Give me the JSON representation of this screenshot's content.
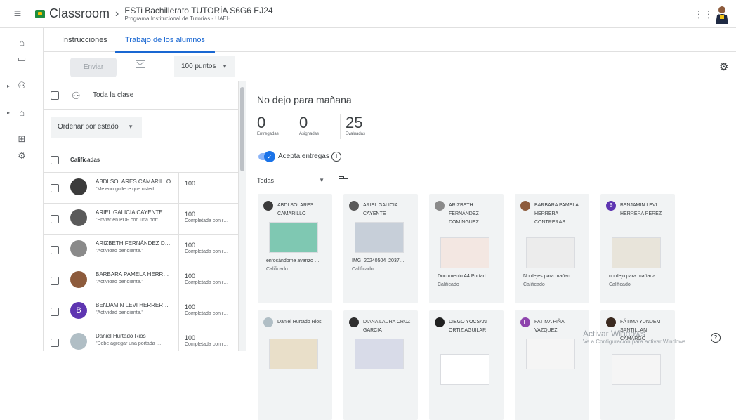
{
  "header": {
    "app_name": "Classroom",
    "course_title": "ESTi Bachillerato TUTORÍA S6G6 EJ24",
    "course_subtitle": "Programa Institucional de Tutorías - UAEH"
  },
  "tabs": [
    {
      "label": "Instrucciones",
      "active": false
    },
    {
      "label": "Trabajo de los alumnos",
      "active": true
    }
  ],
  "toolbar": {
    "send_label": "Enviar",
    "points_value": "100 puntos"
  },
  "left_panel": {
    "whole_class_label": "Toda la clase",
    "sort_label": "Ordenar por estado",
    "graded_header": "Calificadas",
    "students": [
      {
        "name": "ABDI SOLARES CAMARILLO",
        "comment": "\"Me enorgullece que usted …",
        "grade": "100",
        "status": "",
        "avatar_color": "#3b3b3b"
      },
      {
        "name": "ARIEL GALICIA CAYENTE",
        "comment": "\"Enviar en PDF con una port…",
        "grade": "100",
        "status": "Completada con r…",
        "avatar_color": "#5a5a5a"
      },
      {
        "name": "ARIZBETH FERNÁNDEZ D…",
        "comment": "\"Actividad pendiente.\"",
        "grade": "100",
        "status": "Completada con r…",
        "avatar_color": "#8a8a8a"
      },
      {
        "name": "BARBARA PAMELA HERR…",
        "comment": "\"Actividad pendiente.\"",
        "grade": "100",
        "status": "Completada con r…",
        "avatar_color": "#8d5b3c"
      },
      {
        "name": "BENJAMIN LEVI HERRER…",
        "comment": "\"Actividad pendiente.\"",
        "grade": "100",
        "status": "Completada con r…",
        "avatar_color": "#5e35b1",
        "initial": "B"
      },
      {
        "name": "Daniel Hurtado Rios",
        "comment": "\"Debe agregar una portada …",
        "grade": "100",
        "status": "Completada con r…",
        "avatar_color": "#b0bec5"
      }
    ]
  },
  "assignment": {
    "title": "No dejo para mañana",
    "stats": [
      {
        "value": "0",
        "label": "Entregadas"
      },
      {
        "value": "0",
        "label": "Asignadas"
      },
      {
        "value": "25",
        "label": "Evaluadas"
      }
    ],
    "accepting_label": "Acepta entregas",
    "filter_label": "Todas",
    "cards": [
      {
        "name": "ABDI SOLARES CAMARILLO",
        "file": "enfocándome avanzo …",
        "status": "Calificado",
        "avatar_color": "#3b3b3b",
        "thumb_color": "#7fc8b2"
      },
      {
        "name": "ARIEL GALICIA CAYENTE",
        "file": "IMG_20240504_2037…",
        "status": "Calificado",
        "avatar_color": "#5a5a5a",
        "thumb_color": "#c7cfd9"
      },
      {
        "name": "ARIZBETH FERNÁNDEZ DOMÍNGUEZ",
        "file": "Documento A4 Portad…",
        "status": "Calificado",
        "avatar_color": "#8a8a8a",
        "thumb_color": "#f3e7e2"
      },
      {
        "name": "BARBARA PAMELA HERRERA CONTRERAS",
        "file": "No dejes para mañan…",
        "status": "Calificado",
        "avatar_color": "#8d5b3c",
        "thumb_color": "#ececec"
      },
      {
        "name": "BENJAMIN LEVI HERRERA PEREZ",
        "file": "no dejo para mañana.…",
        "status": "Calificado",
        "avatar_color": "#5e35b1",
        "initial": "B",
        "thumb_color": "#e8e4da"
      },
      {
        "name": "Daniel Hurtado Rios",
        "file": "",
        "status": "",
        "avatar_color": "#b0bec5",
        "thumb_color": "#e9dfc9"
      },
      {
        "name": "DIANA LAURA CRUZ GARCIA",
        "file": "",
        "status": "",
        "avatar_color": "#2f2f2f",
        "thumb_color": "#d8dbe8"
      },
      {
        "name": "DIEGO YOCSAN ORTIZ AGUILAR",
        "file": "",
        "status": "",
        "avatar_color": "#202020",
        "thumb_color": "#ffffff"
      },
      {
        "name": "FATIMA PIÑA VAZQUEZ",
        "file": "",
        "status": "",
        "avatar_color": "#8e44ad",
        "initial": "F",
        "thumb_color": "#f5f5f5"
      },
      {
        "name": "FÁTIMA YUNUEM SANTILLAN CAMARGO",
        "file": "",
        "status": "",
        "avatar_color": "#3b2a20",
        "thumb_color": "#f5f5f5"
      }
    ]
  },
  "watermark": {
    "title": "Activar Windows",
    "subtitle": "Ve a Configuración para activar Windows."
  },
  "colors": {
    "accent": "#1967d2",
    "card_bg": "#f1f3f4"
  }
}
